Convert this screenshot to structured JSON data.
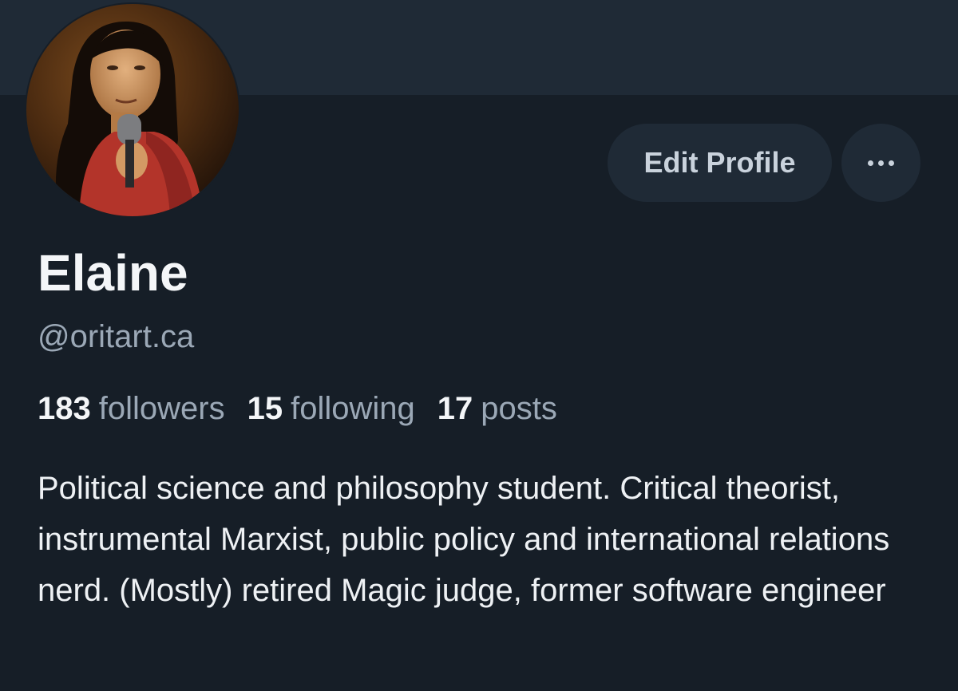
{
  "profile": {
    "display_name": "Elaine",
    "handle": "@oritart.ca",
    "avatar_icon": "profile-photo",
    "bio": "Political science and philosophy student. Critical theorist, instrumental Marxist, public policy and international relations nerd. (Mostly) retired Magic judge, former software engineer"
  },
  "actions": {
    "edit_profile_label": "Edit Profile",
    "more_icon": "ellipsis-icon"
  },
  "stats": {
    "followers_count": "183",
    "followers_label": "followers",
    "following_count": "15",
    "following_label": "following",
    "posts_count": "17",
    "posts_label": "posts"
  },
  "colors": {
    "background": "#161e27",
    "banner": "#1f2a36",
    "button_bg": "#1f2a36",
    "muted_text": "#9ba8b6"
  }
}
